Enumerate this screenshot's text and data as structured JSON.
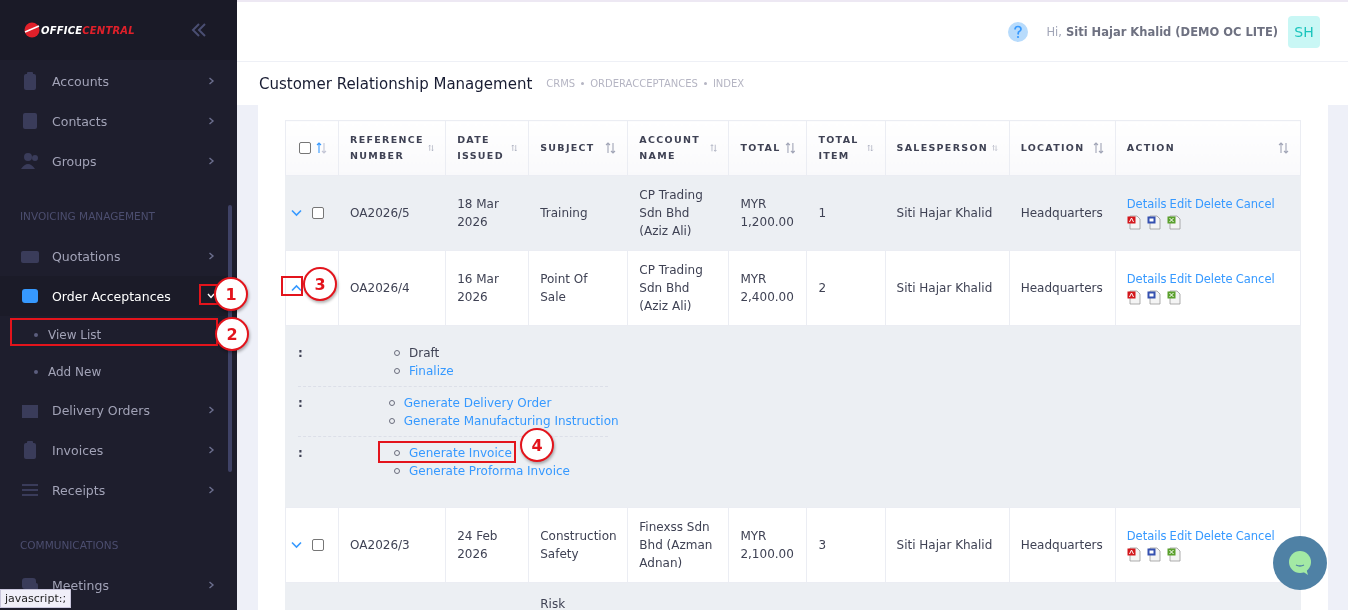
{
  "sidebar": {
    "logo": {
      "part_1": "OFFICE",
      "part_2": "CENTRAL"
    },
    "sections": [
      {
        "items": [
          {
            "label": "Accounts",
            "active": false,
            "expanded": false
          },
          {
            "label": "Contacts",
            "active": false,
            "expanded": false
          },
          {
            "label": "Groups",
            "active": false,
            "expanded": false
          }
        ]
      },
      {
        "heading": "INVOICING MANAGEMENT",
        "items": [
          {
            "label": "Quotations",
            "active": false,
            "expanded": false
          },
          {
            "label": "Order Acceptances",
            "active": true,
            "expanded": true,
            "children": [
              {
                "label": "View List"
              },
              {
                "label": "Add New"
              }
            ]
          },
          {
            "label": "Delivery Orders",
            "active": false,
            "expanded": false
          },
          {
            "label": "Invoices",
            "active": false,
            "expanded": false
          },
          {
            "label": "Receipts",
            "active": false,
            "expanded": false
          }
        ]
      },
      {
        "heading": "COMMUNICATIONS",
        "items": [
          {
            "label": "Meetings",
            "active": false,
            "expanded": false
          }
        ]
      }
    ]
  },
  "status_link": "javascript:;",
  "header": {
    "greeting": "Hi,",
    "user": "Siti Hajar Khalid (DEMO OC LITE)",
    "avatar": "SH"
  },
  "page": {
    "title": "Customer Relationship Management",
    "breadcrumb": [
      "CRMS",
      "ORDERACCEPTANCES",
      "INDEX"
    ]
  },
  "table": {
    "select_all": {
      "checked": false
    },
    "columns": [
      "REFERENCE NUMBER",
      "DATE ISSUED",
      "SUBJECT",
      "ACCOUNT NAME",
      "TOTAL",
      "TOTAL ITEM",
      "SALESPERSON",
      "LOCATION",
      "ACTION"
    ],
    "rows": [
      {
        "kind": "order",
        "expanded": false,
        "checked": false,
        "cells": [
          "OA2026/5",
          "18 Mar 2026",
          "Training",
          "CP Trading Sdn Bhd (Aziz Ali)",
          "MYR 1,200.00",
          "1",
          "Siti Hajar Khalid",
          "Headquarters"
        ],
        "actions": [
          "Details",
          "Edit",
          "Delete",
          "Cancel"
        ]
      },
      {
        "kind": "order",
        "expanded": true,
        "cells": [
          "OA2026/4",
          "16 Mar 2026",
          "Point Of Sale",
          "CP Trading Sdn Bhd (Aziz Ali)",
          "MYR 2,400.00",
          "2",
          "Siti Hajar Khalid",
          "Headquarters"
        ],
        "actions": [
          "Details",
          "Edit",
          "Delete",
          "Cancel"
        ]
      },
      {
        "kind": "detail",
        "groups": [
          {
            "label": ":",
            "items": [
              {
                "text": "Draft",
                "link": false
              },
              {
                "text": "Finalize",
                "link": true
              }
            ]
          },
          {
            "label": ":",
            "items": [
              {
                "text": "Generate Delivery Order",
                "link": true
              },
              {
                "text": "Generate Manufacturing Instruction",
                "link": true
              }
            ]
          },
          {
            "label": ":",
            "items": [
              {
                "text": "Generate Invoice",
                "link": true
              },
              {
                "text": "Generate Proforma Invoice",
                "link": true
              }
            ]
          }
        ]
      },
      {
        "kind": "order",
        "expanded": false,
        "checked": false,
        "cells": [
          "OA2026/3",
          "24 Feb 2026",
          "Construction Safety",
          "Finexss Sdn Bhd (Azman Adnan)",
          "MYR 2,100.00",
          "3",
          "Siti Hajar Khalid",
          "Headquarters"
        ],
        "actions": [
          "Details",
          "Edit",
          "Delete",
          "Cancel"
        ]
      },
      {
        "kind": "partial",
        "subject": "Risk"
      }
    ]
  },
  "annotations": [
    {
      "number": "1"
    },
    {
      "number": "2"
    },
    {
      "number": "3"
    },
    {
      "number": "4"
    }
  ]
}
